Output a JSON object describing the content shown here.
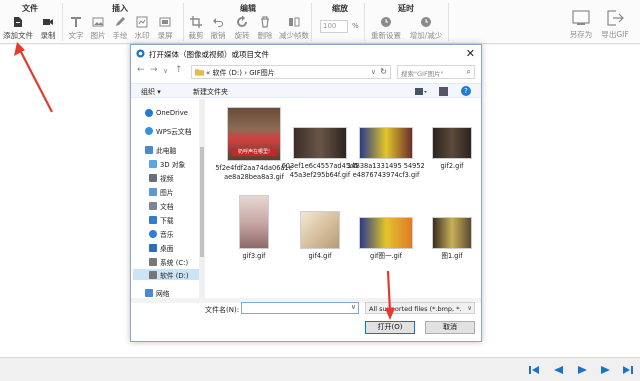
{
  "ribbon": {
    "groups": {
      "file": "文件",
      "insert": "插入",
      "edit": "编辑",
      "zoom": "缩放",
      "delay": "延时"
    },
    "buttons": {
      "add_file": "添加文件",
      "record": "录制",
      "text": "文字",
      "image": "图片",
      "brush": "手绘",
      "watermark": "水印",
      "frame": "录屏",
      "crop": "裁剪",
      "undo": "撤销",
      "rotate": "旋转",
      "delete": "删除",
      "reduce_frames": "减少帧数",
      "reset": "重新设置",
      "increase_decrease": "增加/减少",
      "save_as": "另存为",
      "export_gif": "导出GIF"
    },
    "zoom_value": "100",
    "zoom_unit": "%"
  },
  "dialog": {
    "title": "打开媒体（图像或视频）或项目文件",
    "address": {
      "prefix": "«",
      "path": "软件 (D:)  ›  GIF图片",
      "chevron": "∨",
      "refresh": "↻"
    },
    "search_placeholder": "搜索\"GIF图片\"",
    "commands": {
      "organize": "组织 ▾",
      "new_folder": "新建文件夹"
    },
    "nav": [
      {
        "label": "OneDrive",
        "color": "#1e7bd8"
      },
      {
        "label": "WPS云文档",
        "color": "#3b8fe0"
      },
      {
        "label": "此电脑",
        "color": "#4b8ad1"
      },
      {
        "label": "3D 对象",
        "color": "#5aa7e6"
      },
      {
        "label": "视频",
        "color": "#6a6f7a"
      },
      {
        "label": "图片",
        "color": "#5b9bd5"
      },
      {
        "label": "文档",
        "color": "#7a8796"
      },
      {
        "label": "下载",
        "color": "#2f7dd1"
      },
      {
        "label": "音乐",
        "color": "#2d7ed4"
      },
      {
        "label": "桌面",
        "color": "#2b6fb5"
      },
      {
        "label": "系统 (C:)",
        "color": "#777777"
      },
      {
        "label": "软件 (D:)",
        "color": "#777777"
      },
      {
        "label": "网络",
        "color": "#4b8ad1"
      }
    ],
    "files": [
      {
        "name": "5f2e4fdf2aa74da06a1eae8a28bea8a3.gif",
        "caption": "奶呼声在哪里!"
      },
      {
        "name": "603ef1e6c4557ad45d545a3ef295b64f.gif"
      },
      {
        "name": "14838a1331495 54952e4876743974cf3.gif"
      },
      {
        "name": "gif2.gif"
      },
      {
        "name": "gif3.gif"
      },
      {
        "name": "gif4.gif"
      },
      {
        "name": "gif图一.gif"
      },
      {
        "name": "图1.gif"
      }
    ],
    "filename_label": "文件名(N):",
    "filename_value": "",
    "filter": "All supported files (*.bmp, *.",
    "open_button": "打开(O)",
    "cancel_button": "取消"
  },
  "colors": {
    "accent": "#0078d7",
    "arrow": "#e23b2e",
    "player": "#1a73c8"
  }
}
